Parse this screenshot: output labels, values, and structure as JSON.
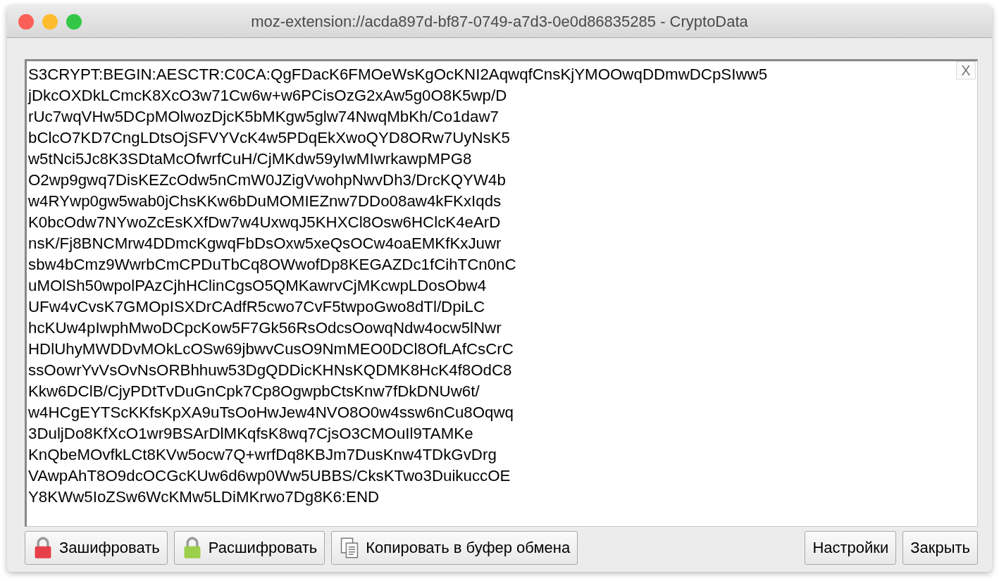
{
  "window": {
    "title": "moz-extension://acda897d-bf87-0749-a7d3-0e0d86835285 - CryptoData"
  },
  "editor": {
    "clear_button": "X",
    "lines": [
      "S3CRYPT:BEGIN:AESCTR:C0CA:QgFDacK6FMOeWsKgOcKNI2AqwqfCnsKjYMOOwqDDmwDCpSIww5",
      "jDkcOXDkLCmcK8XcO3w71Cw6w+w6PCisOzG2xAw5g0O8K5wp/D",
      "rUc7wqVHw5DCpMOlwozDjcK5bMKgw5glw74NwqMbKh/Co1daw7",
      "bClcO7KD7CngLDtsOjSFVYVcK4w5PDqEkXwoQYD8ORw7UyNsK5",
      "w5tNci5Jc8K3SDtaMcOfwrfCuH/CjMKdw59yIwMIwrkawpMPG8",
      "O2wp9gwq7DisKEZcOdw5nCmW0JZigVwohpNwvDh3/DrcKQYW4b",
      "w4RYwp0gw5wab0jChsKKw6bDuMOMIEZnw7DDo08aw4kFKxIqds",
      "K0bcOdw7NYwoZcEsKXfDw7w4UxwqJ5KHXCl8Osw6HClcK4eArD",
      "nsK/Fj8BNCMrw4DDmcKgwqFbDsOxw5xeQsOCw4oaEMKfKxJuwr",
      "sbw4bCmz9WwrbCmCPDuTbCq8OWwofDp8KEGAZDc1fCihTCn0nC",
      "uMOlSh50wpolPAzCjhHClinCgsO5QMKawrvCjMKcwpLDosObw4",
      "UFw4vCvsK7GMOpISXDrCAdfR5cwo7CvF5twpoGwo8dTl/DpiLC",
      "hcKUw4pIwphMwoDCpcKow5F7Gk56RsOdcsOowqNdw4ocw5lNwr",
      "HDlUhyMWDDvMOkLcOSw69jbwvCusO9NmMEO0DCl8OfLAfCsCrC",
      "ssOowrYvVsOvNsORBhhuw53DgQDDicKHNsKQDMK8HcK4f8OdC8",
      "Kkw6DClB/CjyPDtTvDuGnCpk7Cp8OgwpbCtsKnw7fDkDNUw6t/",
      "w4HCgEYTScKKfsKpXA9uTsOoHwJew4NVO8O0w4ssw6nCu8Oqwq",
      "3DuljDo8KfXcO1wr9BSArDlMKqfsK8wq7CjsO3CMOuIl9TAMKe",
      "KnQbeMOvfkLCt8KVw5ocw7Q+wrfDq8KBJm7DusKnw4TDkGvDrg",
      "VAwpAhT8O9dcOCGcKUw6d6wp0Ww5UBBS/CksKTwo3DuikuccOE",
      "Y8KWw5IoZSw6WcKMw5LDiMKrwo7Dg8K6:END"
    ]
  },
  "buttons_left": [
    {
      "label": "Зашифровать",
      "kind": "encrypt"
    },
    {
      "label": "Расшифровать",
      "kind": "decrypt"
    },
    {
      "label": "Копировать в буфер обмена",
      "kind": "copy"
    }
  ],
  "buttons_right": [
    {
      "label": "Настройки"
    },
    {
      "label": "Закрыть"
    }
  ]
}
